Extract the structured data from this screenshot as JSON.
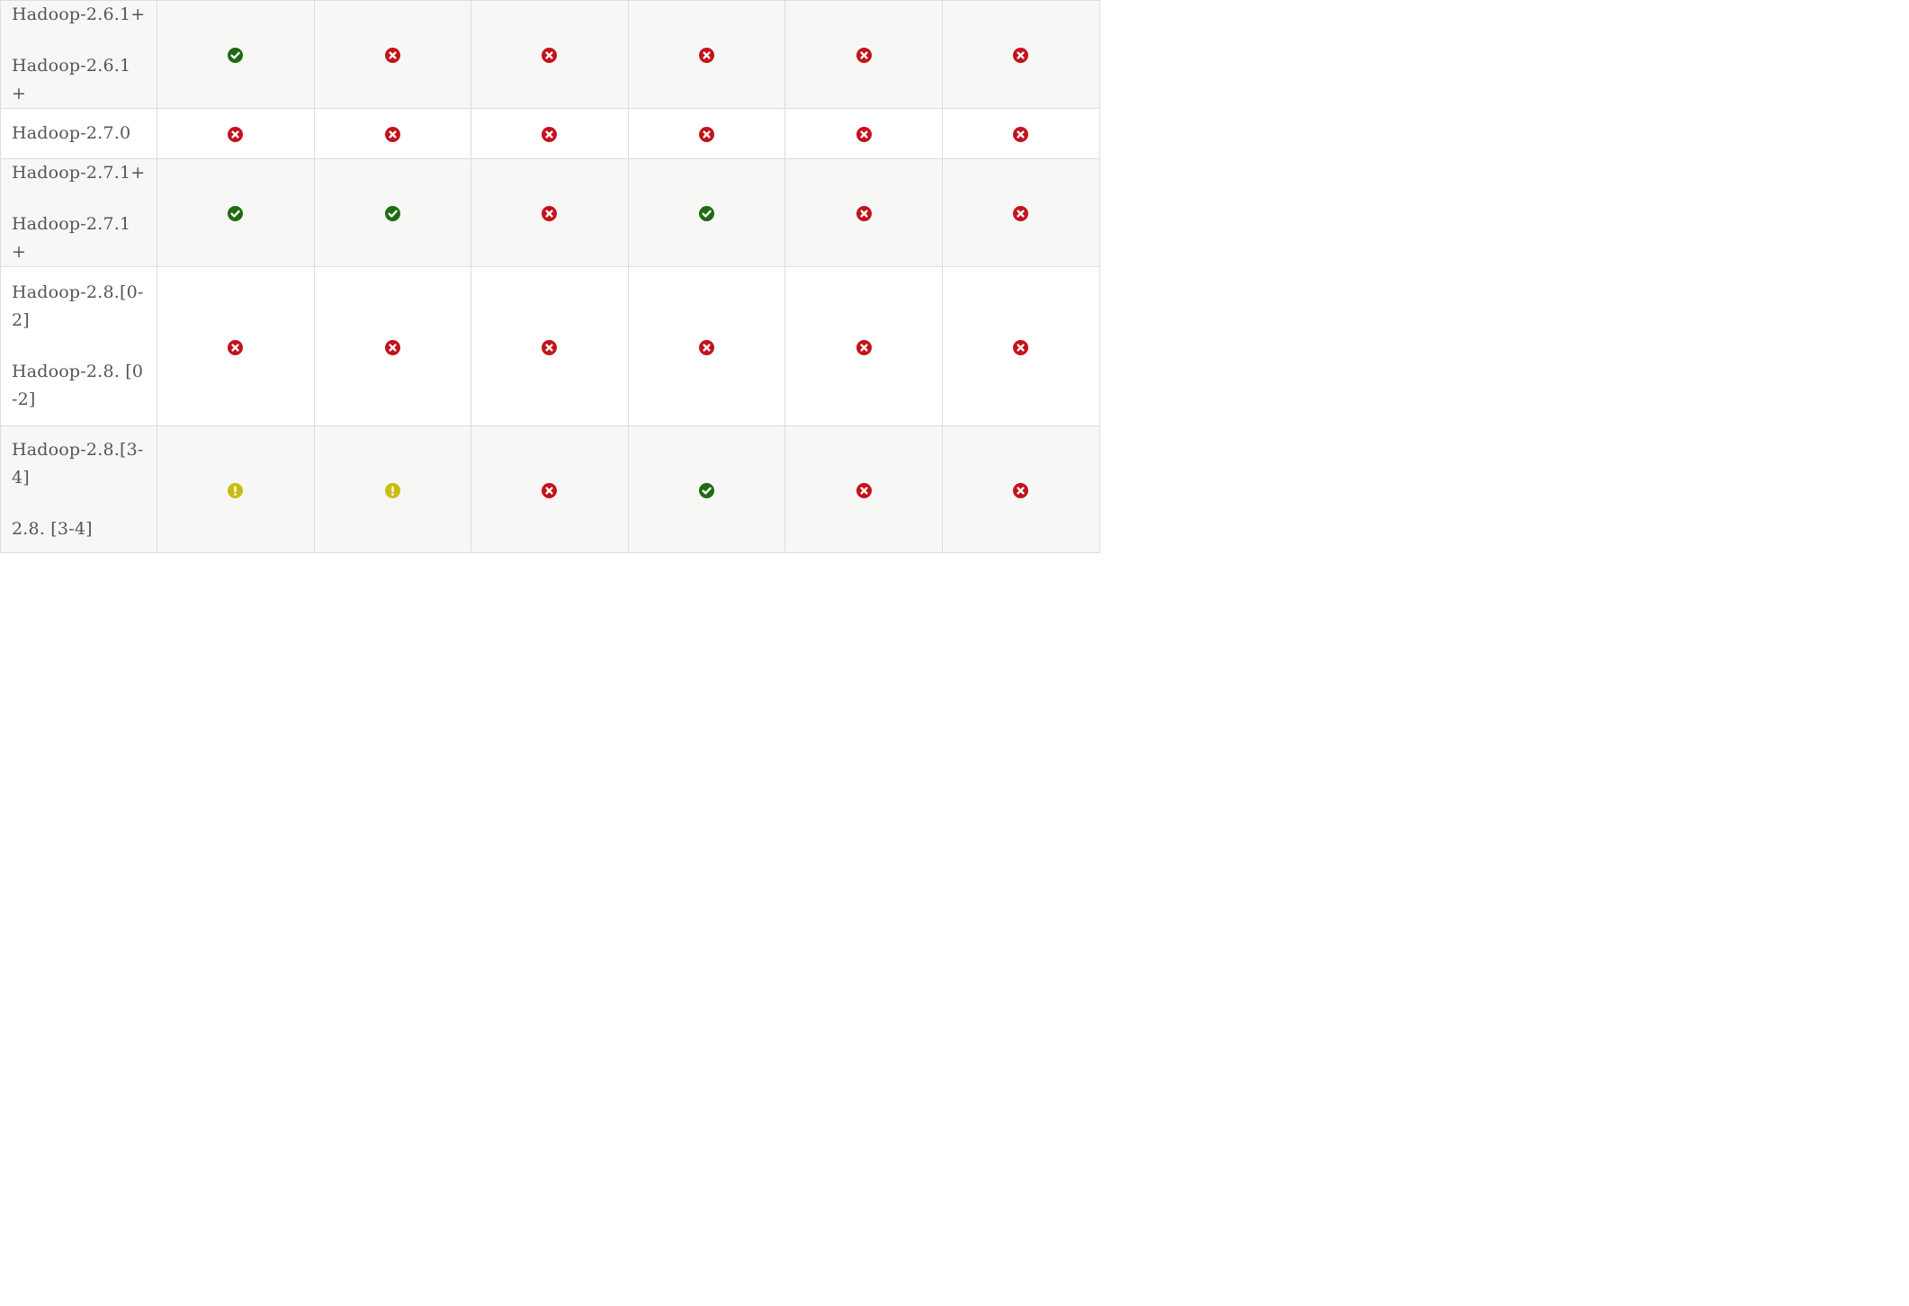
{
  "status_colors": {
    "supported": "#1e6b13",
    "not_supported": "#c4121b",
    "partial": "#c9bd12"
  },
  "icons": {
    "supported": "check-circle-icon",
    "not_supported": "x-circle-icon",
    "partial": "exclamation-circle-icon"
  },
  "table": {
    "rows": [
      {
        "labels": [
          "Hadoop-2.6.1+",
          "Hadoop-2.6.1 +"
        ],
        "cells": [
          "supported",
          "not_supported",
          "not_supported",
          "not_supported",
          "not_supported",
          "not_supported"
        ]
      },
      {
        "labels": [
          "Hadoop-2.7.0"
        ],
        "cells": [
          "not_supported",
          "not_supported",
          "not_supported",
          "not_supported",
          "not_supported",
          "not_supported"
        ]
      },
      {
        "labels": [
          "Hadoop-2.7.1+",
          "Hadoop-2.7.1 +"
        ],
        "cells": [
          "supported",
          "supported",
          "not_supported",
          "supported",
          "not_supported",
          "not_supported"
        ]
      },
      {
        "labels": [
          "Hadoop-2.8.[0-2]",
          "Hadoop-2.8. [0-2]"
        ],
        "cells": [
          "not_supported",
          "not_supported",
          "not_supported",
          "not_supported",
          "not_supported",
          "not_supported"
        ]
      },
      {
        "labels": [
          "Hadoop-2.8.[3-4]",
          "2.8. [3-4]"
        ],
        "cells": [
          "partial",
          "partial",
          "not_supported",
          "supported",
          "not_supported",
          "not_supported"
        ]
      }
    ]
  }
}
